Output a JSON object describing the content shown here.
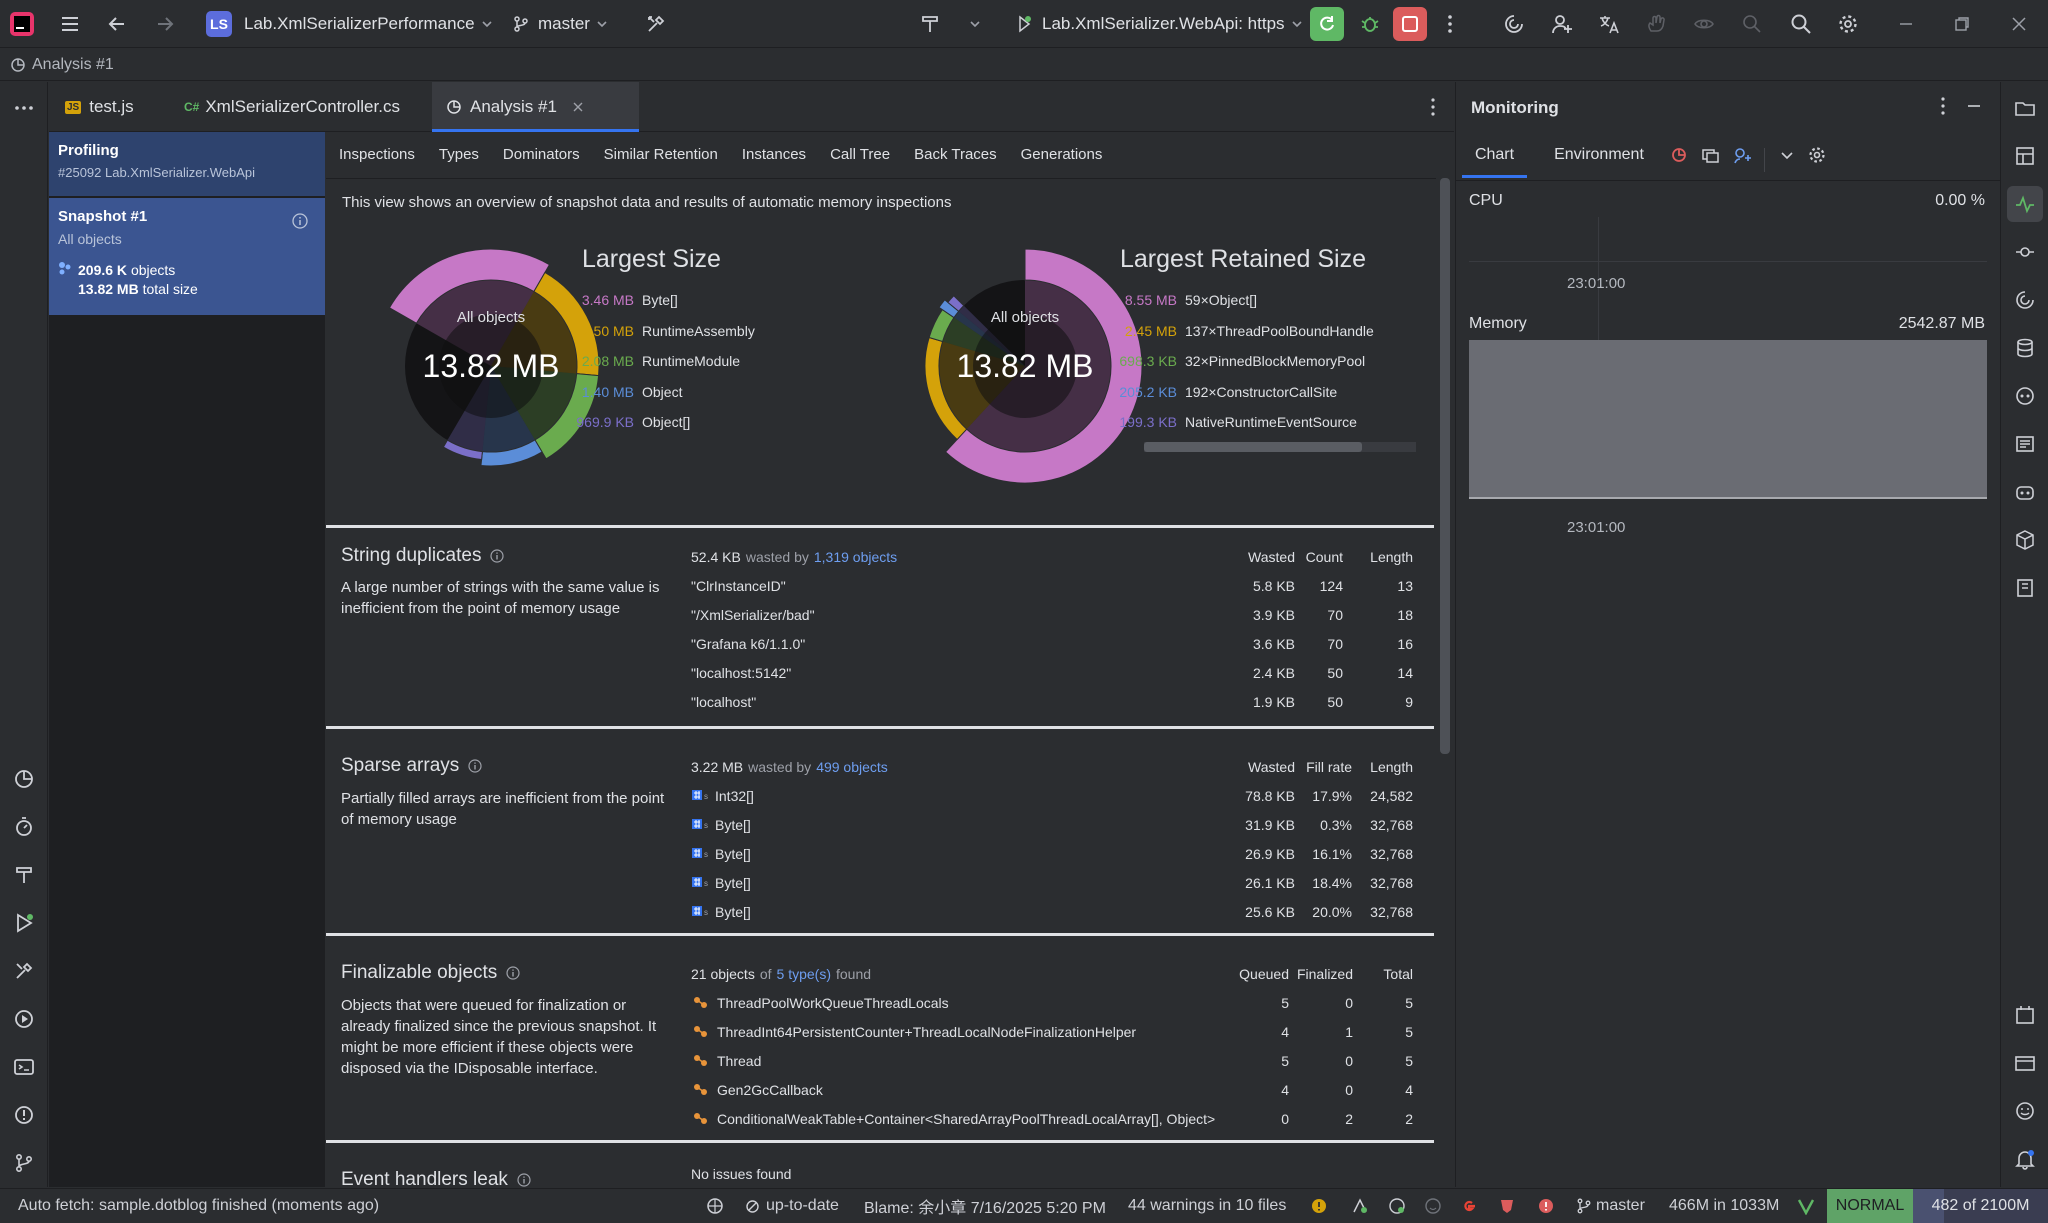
{
  "titlebar": {
    "project_badge": "LS",
    "project_name": "Lab.XmlSerializerPerformance",
    "branch": "master",
    "run_config": "Lab.XmlSerializer.WebApi: https"
  },
  "breadcrumb": "Analysis #1",
  "tabs": [
    {
      "icon_text": "JS",
      "label": "test.js"
    },
    {
      "icon_text": "C#",
      "label": "XmlSerializerController.cs"
    },
    {
      "label": "Analysis #1"
    }
  ],
  "snapshot_panel": {
    "profiling_title": "Profiling",
    "profiling_sub": "#25092 Lab.XmlSerializer.WebApi",
    "snapshot_title": "Snapshot #1",
    "snapshot_sub": "All objects",
    "objects_value": "209.6 K",
    "objects_label": "objects",
    "size_value": "13.82 MB",
    "size_label": "total size"
  },
  "subtabs": [
    "Inspections",
    "Types",
    "Dominators",
    "Similar Retention",
    "Instances",
    "Call Tree",
    "Back Traces",
    "Generations"
  ],
  "overview_text": "This view shows an overview of snapshot data and results of automatic memory inspections",
  "largest_size": {
    "title": "Largest Size",
    "center_label": "All objects",
    "center_value": "13.82 MB",
    "items": [
      {
        "value": "3.46 MB",
        "name": "Byte[]",
        "color": "#c678c6"
      },
      {
        "value": "2.50 MB",
        "name": "RuntimeAssembly",
        "color": "#d4a20a"
      },
      {
        "value": "2.08 MB",
        "name": "RuntimeModule",
        "color": "#6aab4e"
      },
      {
        "value": "1.40 MB",
        "name": "Object",
        "color": "#5b8dd8"
      },
      {
        "value": "969.9 KB",
        "name": "Object[]",
        "color": "#7b6fc9"
      }
    ]
  },
  "largest_retained": {
    "title": "Largest Retained Size",
    "center_label": "All objects",
    "center_value": "13.82 MB",
    "items": [
      {
        "value": "8.55 MB",
        "name": "59×Object[]",
        "color": "#c678c6"
      },
      {
        "value": "2.45 MB",
        "name": "137×ThreadPoolBoundHandle",
        "color": "#d4a20a"
      },
      {
        "value": "698.3 KB",
        "name": "32×PinnedBlockMemoryPool",
        "color": "#6aab4e"
      },
      {
        "value": "205.2 KB",
        "name": "192×ConstructorCallSite",
        "color": "#5b8dd8"
      },
      {
        "value": "199.3 KB",
        "name": "NativeRuntimeEventSource",
        "color": "#7b6fc9"
      }
    ]
  },
  "string_duplicates": {
    "title": "String duplicates",
    "desc": "A large number of strings with the same value is inefficient from the point of memory usage",
    "summary_value": "52.4 KB",
    "summary_mid": "wasted by",
    "summary_link": "1,319 objects",
    "headers": [
      "Wasted",
      "Count",
      "Length"
    ],
    "rows": [
      {
        "name": "\"ClrInstanceID\"",
        "c1": "5.8 KB",
        "c2": "124",
        "c3": "13"
      },
      {
        "name": "\"/XmlSerializer/bad\"",
        "c1": "3.9 KB",
        "c2": "70",
        "c3": "18"
      },
      {
        "name": "\"Grafana k6/1.1.0\"",
        "c1": "3.6 KB",
        "c2": "70",
        "c3": "16"
      },
      {
        "name": "\"localhost:5142\"",
        "c1": "2.4 KB",
        "c2": "50",
        "c3": "14"
      },
      {
        "name": "\"localhost\"",
        "c1": "1.9 KB",
        "c2": "50",
        "c3": "9"
      }
    ]
  },
  "sparse_arrays": {
    "title": "Sparse arrays",
    "desc": "Partially filled arrays are inefficient from the point of memory usage",
    "summary_value": "3.22 MB",
    "summary_mid": "wasted by",
    "summary_link": "499 objects",
    "headers": [
      "Wasted",
      "Fill rate",
      "Length"
    ],
    "rows": [
      {
        "name": "Int32[]",
        "c1": "78.8 KB",
        "c2": "17.9%",
        "c3": "24,582"
      },
      {
        "name": "Byte[]",
        "c1": "31.9 KB",
        "c2": "0.3%",
        "c3": "32,768"
      },
      {
        "name": "Byte[]",
        "c1": "26.9 KB",
        "c2": "16.1%",
        "c3": "32,768"
      },
      {
        "name": "Byte[]",
        "c1": "26.1 KB",
        "c2": "18.4%",
        "c3": "32,768"
      },
      {
        "name": "Byte[]",
        "c1": "25.6 KB",
        "c2": "20.0%",
        "c3": "32,768"
      }
    ]
  },
  "finalizable": {
    "title": "Finalizable objects",
    "desc": "Objects that were queued for finalization or already finalized since the previous snapshot. It might be more efficient if these objects were disposed via the IDisposable interface.",
    "summary_value": "21 objects",
    "summary_mid": "of",
    "summary_link": "5 type(s)",
    "summary_end": "found",
    "headers": [
      "Queued",
      "Finalized",
      "Total"
    ],
    "rows": [
      {
        "name": "ThreadPoolWorkQueueThreadLocals",
        "c1": "5",
        "c2": "0",
        "c3": "5"
      },
      {
        "name": "ThreadInt64PersistentCounter+ThreadLocalNodeFinalizationHelper",
        "c1": "4",
        "c2": "1",
        "c3": "5"
      },
      {
        "name": "Thread",
        "c1": "5",
        "c2": "0",
        "c3": "5"
      },
      {
        "name": "Gen2GcCallback",
        "c1": "4",
        "c2": "0",
        "c3": "4"
      },
      {
        "name": "ConditionalWeakTable+Container<SharedArrayPoolThreadLocalArray[], Object>",
        "c1": "0",
        "c2": "2",
        "c3": "2"
      }
    ]
  },
  "event_handlers": {
    "title": "Event handlers leak",
    "summary": "No issues found"
  },
  "monitoring": {
    "title": "Monitoring",
    "tabs": [
      "Chart",
      "Environment"
    ],
    "cpu_label": "CPU",
    "cpu_value": "0.00 %",
    "cpu_time": "23:01:00",
    "memory_label": "Memory",
    "memory_value": "2542.87 MB",
    "memory_time": "23:01:00"
  },
  "statusbar": {
    "left": "Auto fetch: sample.dotblog finished (moments ago)",
    "uptodate": "up-to-date",
    "blame": "Blame: 余小章 7/16/2025 5:20 PM",
    "warnings": "44 warnings in 10 files",
    "branch": "master",
    "memory": "466M in 1033M",
    "mode": "NORMAL",
    "position": "482 of 2100M"
  }
}
